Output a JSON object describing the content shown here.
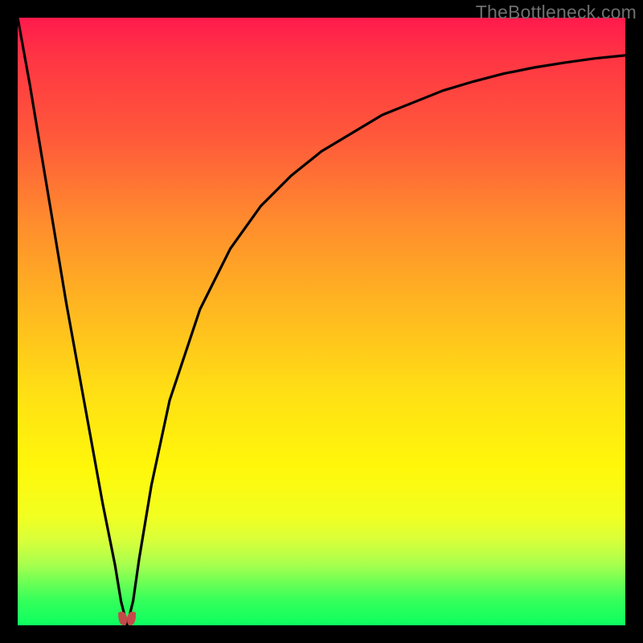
{
  "watermark": "TheBottleneck.com",
  "chart_data": {
    "type": "line",
    "title": "",
    "xlabel": "",
    "ylabel": "",
    "x_range": [
      0,
      100
    ],
    "y_range": [
      0,
      100
    ],
    "dip_x_percent": 18,
    "series": [
      {
        "name": "bottleneck-curve",
        "x_percent": [
          0,
          2,
          4,
          6,
          8,
          10,
          12,
          14,
          16,
          17,
          18,
          19,
          20,
          22,
          25,
          30,
          35,
          40,
          45,
          50,
          55,
          60,
          65,
          70,
          75,
          80,
          85,
          90,
          95,
          100
        ],
        "y_percent": [
          100,
          89,
          77,
          65,
          53,
          42,
          31,
          20,
          10,
          4,
          0,
          4,
          11,
          23,
          37,
          52,
          62,
          69,
          74,
          78,
          81,
          84,
          86,
          88,
          89.5,
          90.8,
          91.8,
          92.6,
          93.3,
          93.8
        ]
      }
    ],
    "gradient_stops": [
      {
        "pct": 0,
        "color": "#ff1a4d"
      },
      {
        "pct": 20,
        "color": "#ff5a3a"
      },
      {
        "pct": 48,
        "color": "#ffb820"
      },
      {
        "pct": 74,
        "color": "#fff70a"
      },
      {
        "pct": 100,
        "color": "#0cff60"
      }
    ],
    "marker": {
      "color": "#c44a4a",
      "shape": "u-blob"
    }
  }
}
